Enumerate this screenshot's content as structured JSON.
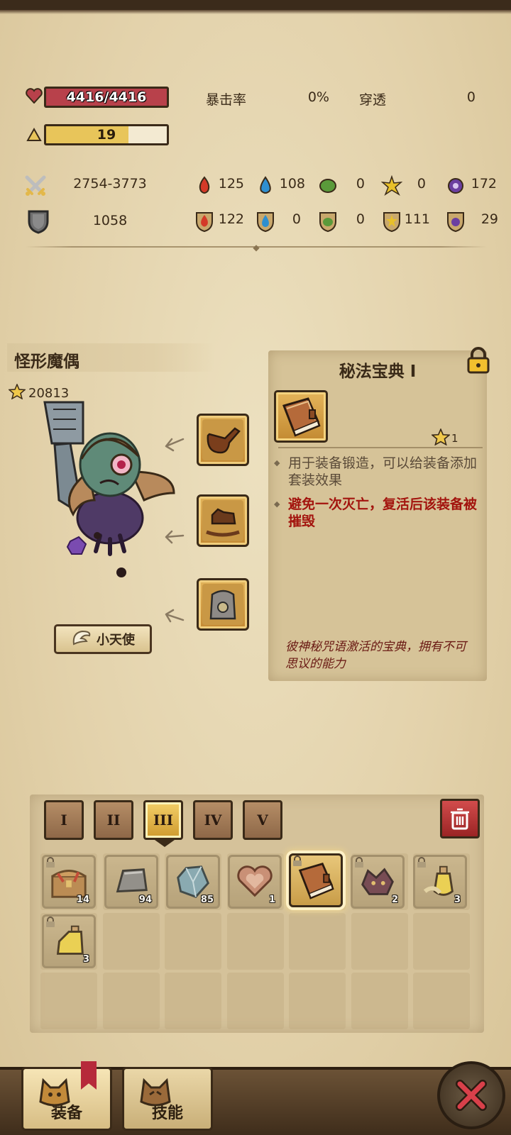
{
  "stats": {
    "hp": "4416/4416",
    "hp_fraction": 1.0,
    "level": "19",
    "level_fraction": 0.68,
    "crit_label": "暴击率",
    "crit_value": "0%",
    "pierce_label": "穿透",
    "pierce_value": "0",
    "attack_range": "2754-3773",
    "defense": "1058",
    "attack_elements": [
      "125",
      "108",
      "0",
      "0",
      "172"
    ],
    "defense_elements": [
      "122",
      "0",
      "0",
      "111",
      "29"
    ]
  },
  "monster": {
    "name": "怪形魔偶",
    "score": "20813",
    "angel_label": "小天使"
  },
  "detail": {
    "title": "秘法宝典 I",
    "star_level": "1",
    "desc_1": "用于装备锻造，可以给装备添加套装效果",
    "desc_2": "避免一次灭亡，复活后该装备被摧毁",
    "flavor": "彼神秘咒语激活的宝典，拥有不可思议的能力"
  },
  "inventory": {
    "tabs": [
      "I",
      "II",
      "III",
      "IV",
      "V"
    ],
    "active_tab": 2,
    "items": [
      {
        "icon": "treasure-chest-icon",
        "count": "14",
        "locked": true
      },
      {
        "icon": "iron-ingot-icon",
        "count": "94",
        "locked": false
      },
      {
        "icon": "crystal-icon",
        "count": "85",
        "locked": false
      },
      {
        "icon": "heart-icon",
        "count": "1",
        "locked": false
      },
      {
        "icon": "spellbook-icon",
        "count": "",
        "locked": true
      },
      {
        "icon": "wolf-head-icon",
        "count": "2",
        "locked": true
      },
      {
        "icon": "potion-icon",
        "count": "3",
        "locked": true
      },
      {
        "icon": "potion-bottle-icon",
        "count": "3",
        "locked": true
      }
    ]
  },
  "nav": {
    "equip_label": "装备",
    "skill_label": "技能"
  },
  "colors": {
    "hp": "#b8414b",
    "level": "#e8c55a",
    "parchment": "#e6d7b3",
    "accent_red": "#a3140e"
  }
}
